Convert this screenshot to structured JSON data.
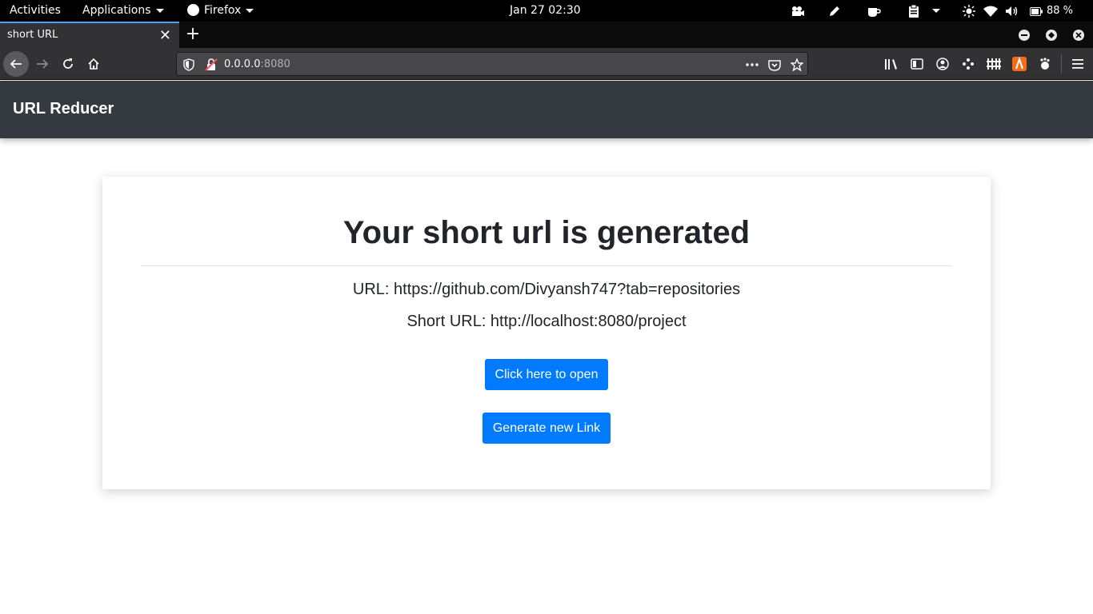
{
  "system_bar": {
    "activities": "Activities",
    "applications": "Applications",
    "firefox": "Firefox",
    "clock": "Jan 27  02:30",
    "battery": "88 %"
  },
  "browser": {
    "tab_title": "short  URL",
    "url_host": "0.0.0.0",
    "url_port": ":8080"
  },
  "app": {
    "brand": "URL Reducer",
    "heading": "Your short url is generated",
    "url_line": "URL: https://github.com/Divyansh747?tab=repositories",
    "short_url_line": "Short URL: http://localhost:8080/project",
    "open_button": "Click here to open",
    "new_link_button": "Generate new Link"
  },
  "colors": {
    "header_bg": "#343a40",
    "button_bg": "#007bff",
    "text": "#212529"
  }
}
